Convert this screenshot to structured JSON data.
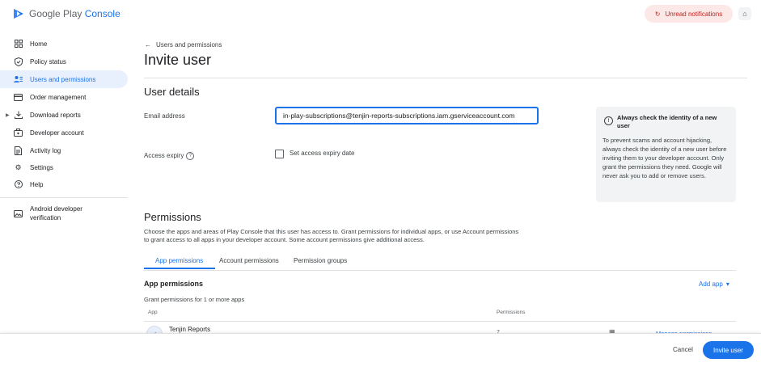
{
  "header": {
    "logo_text_main": "Google Play ",
    "logo_text_accent": "Console",
    "unread_notifications": "Unread notifications"
  },
  "sidebar": {
    "items": [
      {
        "label": "Home",
        "icon": "grid-icon"
      },
      {
        "label": "Policy status",
        "icon": "shield-icon"
      },
      {
        "label": "Users and permissions",
        "icon": "people-icon",
        "active": true
      },
      {
        "label": "Order management",
        "icon": "card-icon"
      },
      {
        "label": "Download reports",
        "icon": "download-icon"
      },
      {
        "label": "Developer account",
        "icon": "briefcase-icon"
      },
      {
        "label": "Activity log",
        "icon": "document-icon"
      },
      {
        "label": "Settings",
        "icon": "gear-icon"
      },
      {
        "label": "Help",
        "icon": "help-icon"
      },
      {
        "label": "Android developer verification",
        "icon": "image-icon"
      }
    ]
  },
  "main": {
    "breadcrumb": "Users and permissions",
    "title": "Invite user",
    "user_details": {
      "heading": "User details",
      "email_label": "Email address",
      "email_value": "in-play-subscriptions@tenjin-reports-subscriptions.iam.gserviceaccount.com",
      "expiry_label": "Access expiry",
      "expiry_checkbox_label": "Set access expiry date"
    },
    "info_card": {
      "title": "Always check the identity of a new user",
      "body": "To prevent scams and account hijacking, always check the identity of a new user before inviting them to your developer account. Only grant the permissions they need. Google will never ask you to add or remove users."
    },
    "permissions": {
      "heading": "Permissions",
      "description": "Choose the apps and areas of Play Console that this user has access to. Grant permissions for individual apps, or use Account permissions to grant access to all apps in your developer account. Some account permissions give additional access.",
      "tabs": [
        "App permissions",
        "Account permissions",
        "Permission groups"
      ],
      "app_permissions_title": "App permissions",
      "add_app": "Add app",
      "grant_text": "Grant permissions for 1 or more apps",
      "columns": [
        "App",
        "Permissions"
      ],
      "rows": [
        {
          "app": "Tenjin Reports",
          "permissions": "7",
          "manage": "Manage permissions"
        }
      ]
    }
  },
  "footer": {
    "cancel": "Cancel",
    "invite": "Invite user"
  },
  "colors": {
    "accent": "#1a73e8",
    "active_bg": "#e8f0fe",
    "notification_bg": "#fce8e6",
    "notification_text": "#c5221f"
  }
}
